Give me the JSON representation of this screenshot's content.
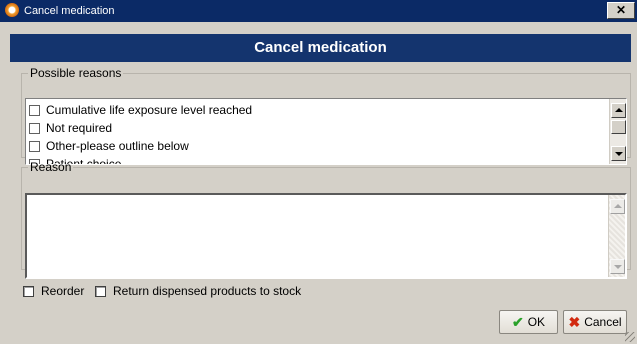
{
  "window": {
    "title": "Cancel medication",
    "close_glyph": "✕"
  },
  "header": {
    "title": "Cancel medication",
    "background": "#14346e"
  },
  "possible_reasons": {
    "legend": "Possible reasons",
    "items": [
      {
        "label": "Cumulative life exposure level reached",
        "checked": false
      },
      {
        "label": "Not required",
        "checked": false
      },
      {
        "label": "Other-please outline below",
        "checked": false
      },
      {
        "label": "Patient choice",
        "checked": false
      }
    ]
  },
  "reason": {
    "legend": "Reason",
    "value": ""
  },
  "options": {
    "reorder_label": "Reorder",
    "return_label": "Return dispensed products to stock"
  },
  "buttons": {
    "ok_label": "OK",
    "ok_icon": "checkmark-icon",
    "cancel_label": "Cancel",
    "cancel_icon": "x-icon"
  },
  "colors": {
    "titlebar": "#0b2a66",
    "dialog_bg": "#d4d0c8",
    "ok_icon": "#2aa12a",
    "cancel_icon": "#d22a10"
  }
}
